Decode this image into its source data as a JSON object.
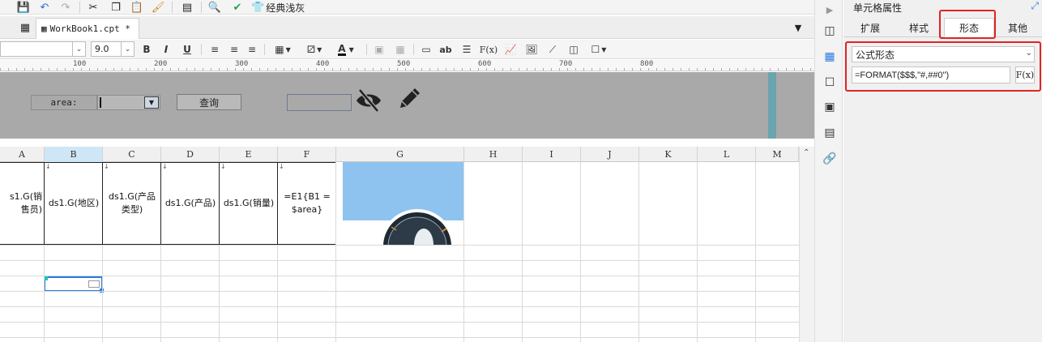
{
  "toolbar": {
    "theme_label": "经典浅灰"
  },
  "tabs": [
    {
      "label": "WorkBook1.cpt *"
    }
  ],
  "format_bar": {
    "font_name": "",
    "font_size": "9.0",
    "bold": "B",
    "italic": "I",
    "underline": "U",
    "text_tool": "ab",
    "fx": "F(x)",
    "font_color_letter": "A"
  },
  "ruler": {
    "labels": [
      "100",
      "200",
      "300",
      "400",
      "500",
      "600",
      "700",
      "800"
    ]
  },
  "parameter_panel": {
    "label": "area:",
    "query_button": "查询"
  },
  "columns": [
    "A",
    "B",
    "C",
    "D",
    "E",
    "F",
    "G",
    "H",
    "I",
    "J",
    "K",
    "L",
    "M"
  ],
  "header_cells": [
    "s1.G(销售员)",
    "ds1.G(地区)",
    "ds1.G(产品类型)",
    "ds1.G(产品)",
    "ds1.G(销量)",
    "=E1{B1 = $area}"
  ],
  "panel": {
    "title": "单元格属性",
    "tabs": [
      "扩展",
      "样式",
      "形态",
      "其他"
    ],
    "active_tab": "形态",
    "form_type": "公式形态",
    "formula": "=FORMAT($$$,\"#,##0\")",
    "fx_label": "F(x)"
  },
  "colors": {
    "accent": "#2a7ae2",
    "highlight": "#e02424",
    "param_bg": "#a9a9a9"
  }
}
